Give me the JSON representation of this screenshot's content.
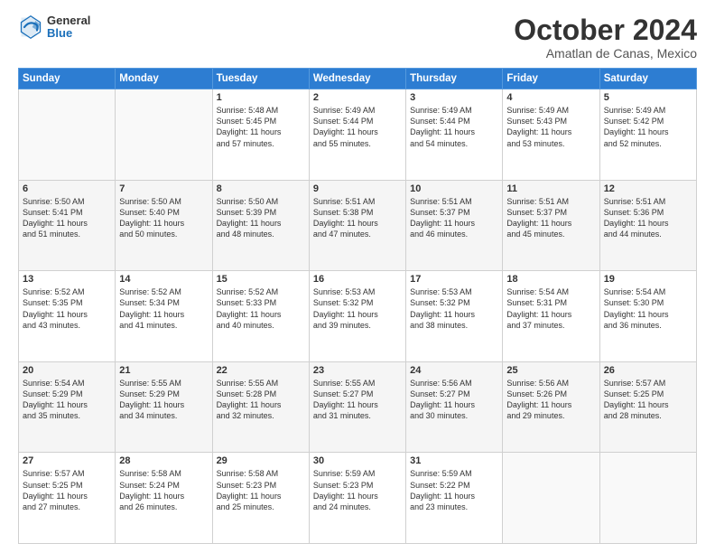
{
  "header": {
    "logo_general": "General",
    "logo_blue": "Blue",
    "month_title": "October 2024",
    "location": "Amatlan de Canas, Mexico"
  },
  "days_of_week": [
    "Sunday",
    "Monday",
    "Tuesday",
    "Wednesday",
    "Thursday",
    "Friday",
    "Saturday"
  ],
  "weeks": [
    [
      {
        "day": "",
        "lines": []
      },
      {
        "day": "",
        "lines": []
      },
      {
        "day": "1",
        "lines": [
          "Sunrise: 5:48 AM",
          "Sunset: 5:45 PM",
          "Daylight: 11 hours",
          "and 57 minutes."
        ]
      },
      {
        "day": "2",
        "lines": [
          "Sunrise: 5:49 AM",
          "Sunset: 5:44 PM",
          "Daylight: 11 hours",
          "and 55 minutes."
        ]
      },
      {
        "day": "3",
        "lines": [
          "Sunrise: 5:49 AM",
          "Sunset: 5:44 PM",
          "Daylight: 11 hours",
          "and 54 minutes."
        ]
      },
      {
        "day": "4",
        "lines": [
          "Sunrise: 5:49 AM",
          "Sunset: 5:43 PM",
          "Daylight: 11 hours",
          "and 53 minutes."
        ]
      },
      {
        "day": "5",
        "lines": [
          "Sunrise: 5:49 AM",
          "Sunset: 5:42 PM",
          "Daylight: 11 hours",
          "and 52 minutes."
        ]
      }
    ],
    [
      {
        "day": "6",
        "lines": [
          "Sunrise: 5:50 AM",
          "Sunset: 5:41 PM",
          "Daylight: 11 hours",
          "and 51 minutes."
        ]
      },
      {
        "day": "7",
        "lines": [
          "Sunrise: 5:50 AM",
          "Sunset: 5:40 PM",
          "Daylight: 11 hours",
          "and 50 minutes."
        ]
      },
      {
        "day": "8",
        "lines": [
          "Sunrise: 5:50 AM",
          "Sunset: 5:39 PM",
          "Daylight: 11 hours",
          "and 48 minutes."
        ]
      },
      {
        "day": "9",
        "lines": [
          "Sunrise: 5:51 AM",
          "Sunset: 5:38 PM",
          "Daylight: 11 hours",
          "and 47 minutes."
        ]
      },
      {
        "day": "10",
        "lines": [
          "Sunrise: 5:51 AM",
          "Sunset: 5:37 PM",
          "Daylight: 11 hours",
          "and 46 minutes."
        ]
      },
      {
        "day": "11",
        "lines": [
          "Sunrise: 5:51 AM",
          "Sunset: 5:37 PM",
          "Daylight: 11 hours",
          "and 45 minutes."
        ]
      },
      {
        "day": "12",
        "lines": [
          "Sunrise: 5:51 AM",
          "Sunset: 5:36 PM",
          "Daylight: 11 hours",
          "and 44 minutes."
        ]
      }
    ],
    [
      {
        "day": "13",
        "lines": [
          "Sunrise: 5:52 AM",
          "Sunset: 5:35 PM",
          "Daylight: 11 hours",
          "and 43 minutes."
        ]
      },
      {
        "day": "14",
        "lines": [
          "Sunrise: 5:52 AM",
          "Sunset: 5:34 PM",
          "Daylight: 11 hours",
          "and 41 minutes."
        ]
      },
      {
        "day": "15",
        "lines": [
          "Sunrise: 5:52 AM",
          "Sunset: 5:33 PM",
          "Daylight: 11 hours",
          "and 40 minutes."
        ]
      },
      {
        "day": "16",
        "lines": [
          "Sunrise: 5:53 AM",
          "Sunset: 5:32 PM",
          "Daylight: 11 hours",
          "and 39 minutes."
        ]
      },
      {
        "day": "17",
        "lines": [
          "Sunrise: 5:53 AM",
          "Sunset: 5:32 PM",
          "Daylight: 11 hours",
          "and 38 minutes."
        ]
      },
      {
        "day": "18",
        "lines": [
          "Sunrise: 5:54 AM",
          "Sunset: 5:31 PM",
          "Daylight: 11 hours",
          "and 37 minutes."
        ]
      },
      {
        "day": "19",
        "lines": [
          "Sunrise: 5:54 AM",
          "Sunset: 5:30 PM",
          "Daylight: 11 hours",
          "and 36 minutes."
        ]
      }
    ],
    [
      {
        "day": "20",
        "lines": [
          "Sunrise: 5:54 AM",
          "Sunset: 5:29 PM",
          "Daylight: 11 hours",
          "and 35 minutes."
        ]
      },
      {
        "day": "21",
        "lines": [
          "Sunrise: 5:55 AM",
          "Sunset: 5:29 PM",
          "Daylight: 11 hours",
          "and 34 minutes."
        ]
      },
      {
        "day": "22",
        "lines": [
          "Sunrise: 5:55 AM",
          "Sunset: 5:28 PM",
          "Daylight: 11 hours",
          "and 32 minutes."
        ]
      },
      {
        "day": "23",
        "lines": [
          "Sunrise: 5:55 AM",
          "Sunset: 5:27 PM",
          "Daylight: 11 hours",
          "and 31 minutes."
        ]
      },
      {
        "day": "24",
        "lines": [
          "Sunrise: 5:56 AM",
          "Sunset: 5:27 PM",
          "Daylight: 11 hours",
          "and 30 minutes."
        ]
      },
      {
        "day": "25",
        "lines": [
          "Sunrise: 5:56 AM",
          "Sunset: 5:26 PM",
          "Daylight: 11 hours",
          "and 29 minutes."
        ]
      },
      {
        "day": "26",
        "lines": [
          "Sunrise: 5:57 AM",
          "Sunset: 5:25 PM",
          "Daylight: 11 hours",
          "and 28 minutes."
        ]
      }
    ],
    [
      {
        "day": "27",
        "lines": [
          "Sunrise: 5:57 AM",
          "Sunset: 5:25 PM",
          "Daylight: 11 hours",
          "and 27 minutes."
        ]
      },
      {
        "day": "28",
        "lines": [
          "Sunrise: 5:58 AM",
          "Sunset: 5:24 PM",
          "Daylight: 11 hours",
          "and 26 minutes."
        ]
      },
      {
        "day": "29",
        "lines": [
          "Sunrise: 5:58 AM",
          "Sunset: 5:23 PM",
          "Daylight: 11 hours",
          "and 25 minutes."
        ]
      },
      {
        "day": "30",
        "lines": [
          "Sunrise: 5:59 AM",
          "Sunset: 5:23 PM",
          "Daylight: 11 hours",
          "and 24 minutes."
        ]
      },
      {
        "day": "31",
        "lines": [
          "Sunrise: 5:59 AM",
          "Sunset: 5:22 PM",
          "Daylight: 11 hours",
          "and 23 minutes."
        ]
      },
      {
        "day": "",
        "lines": []
      },
      {
        "day": "",
        "lines": []
      }
    ]
  ]
}
